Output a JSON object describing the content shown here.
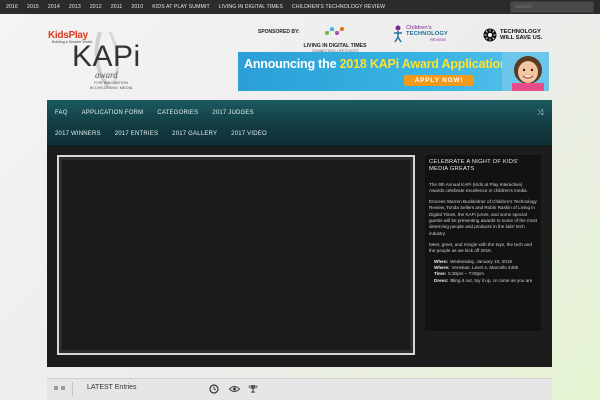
{
  "topbar": {
    "nav": [
      "2016",
      "2015",
      "2014",
      "2013",
      "2012",
      "2011",
      "2010",
      "KIDS AT PLAY SUMMIT",
      "LIVING IN DIGITAL TIMES",
      "CHILDREN'S TECHNOLOGY REVIEW"
    ],
    "search_placeholder": "search"
  },
  "header": {
    "kidsplay_logo": "KidsPlay",
    "kidsplay_tagline": "Building a Smarter World",
    "kapi_title": "KAPi",
    "kapi_award": "award",
    "kapi_sub_1": "FOR INNOVATION",
    "kapi_sub_2": "IN CHILDRENS' MEDIA",
    "sponsored_by": "SPONSORED BY:",
    "ldt_name": "LIVING IN DIGITAL TIMES",
    "ldt_sub": "CONNECTING LIFE'S DOTS",
    "ctr_line1": "Children's",
    "ctr_line2": "TECHNOLOGY",
    "ctr_line3": "REVIEW",
    "tws_line1": "TECHNOLOGY",
    "tws_line2": "WILL SAVE US."
  },
  "banner": {
    "headline_pre": "Announcing the ",
    "headline_highlight": "2018 KAPi Award Application",
    "apply_label": "APPLY NOW!",
    "bg_color": "#2b9fd6"
  },
  "menu": {
    "row1": [
      "FAQ",
      "APPLICATION FORM",
      "CATEGORIES",
      "2017 JUDGES"
    ],
    "row2": [
      "2017 WINNERS",
      "2017 ENTRIES",
      "2017 GALLERY",
      "2017 VIDEO"
    ],
    "shuffle_icon": "shuffle-icon"
  },
  "sidebar": {
    "title": "CELEBRATE A NIGHT OF KIDS' MEDIA GREATS",
    "p1": "The 9th Annual KAPi (Kids at Play Interactive) Awards celebrate excellence in children's media.",
    "p2": "Emcees Warren Buckleitner of Children's Technology Review, Tonda Sellers and Robin Raskin of Living in Digital Times, the KAPi jurors, and some special guests will be presenting awards to some of the most deserving people and products in the kids' tech industry.",
    "p3": "Meet, greet, and mingle with the toys, the tech and the people as we kick off 2018.",
    "when_label": "When:",
    "when_value": "Wednesday, January 10, 2018",
    "where_label": "Where:",
    "where_value": "Venetian, Level 4, Marcello 4405",
    "time_label": "Time:",
    "time_value": "5:30pm – 7:00pm",
    "dress_label": "Dress:",
    "dress_value": "Bling it out, toy it up, or come as you are"
  },
  "tabs": {
    "title": "LATEST Entries",
    "icons": [
      "clock-icon",
      "eye-icon",
      "trophy-icon"
    ]
  }
}
